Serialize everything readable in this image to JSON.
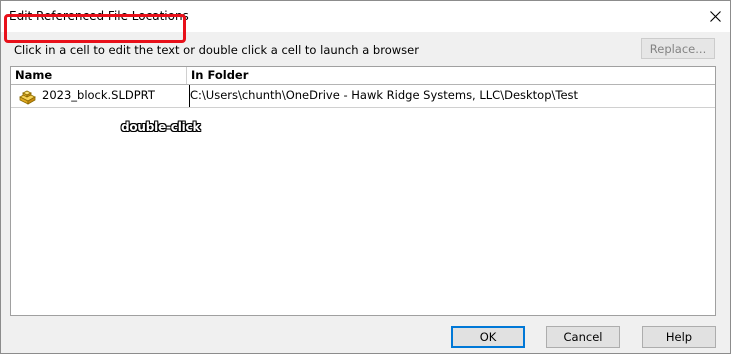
{
  "window": {
    "title": "Edit Referenced File Locations"
  },
  "instruction": "Click in a cell to edit the text or double click a cell to launch a browser",
  "toolbar": {
    "replace_label": "Replace..."
  },
  "grid": {
    "columns": [
      "Name",
      "In Folder"
    ],
    "rows": [
      {
        "name": "2023_block.SLDPRT",
        "folder": "C:\\Users\\chunth\\OneDrive - Hawk Ridge Systems, LLC\\Desktop\\Test",
        "icon": "part-icon"
      }
    ]
  },
  "annotation": {
    "callout": "double-click",
    "highlight_color": "#e8101a"
  },
  "footer": {
    "ok_label": "OK",
    "cancel_label": "Cancel",
    "help_label": "Help"
  }
}
